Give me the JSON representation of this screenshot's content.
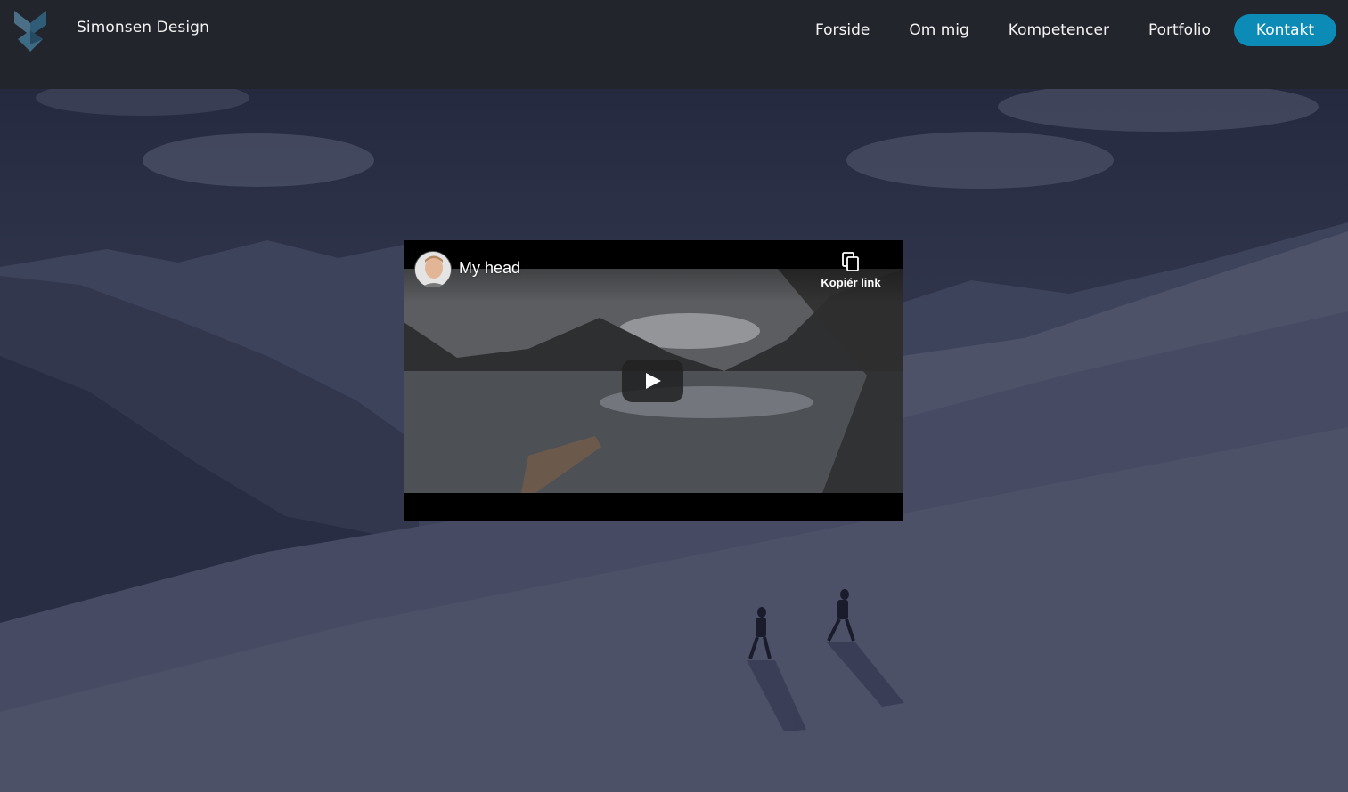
{
  "header": {
    "brand": "Simonsen Design",
    "logo_icon": "simonsen-design-logo-icon"
  },
  "nav": {
    "items": [
      {
        "label": "Forside"
      },
      {
        "label": "Om mig"
      },
      {
        "label": "Kompetencer"
      },
      {
        "label": "Portfolio"
      }
    ],
    "cta": {
      "label": "Kontakt"
    }
  },
  "video": {
    "title": "My head",
    "copy_label": "Kopiér link",
    "copy_icon": "copy-icon",
    "play_icon": "play-icon",
    "avatar_icon": "channel-avatar"
  },
  "colors": {
    "header_bg": "#23252d",
    "accent": "#0b8bb5",
    "video_bg": "#000000"
  }
}
